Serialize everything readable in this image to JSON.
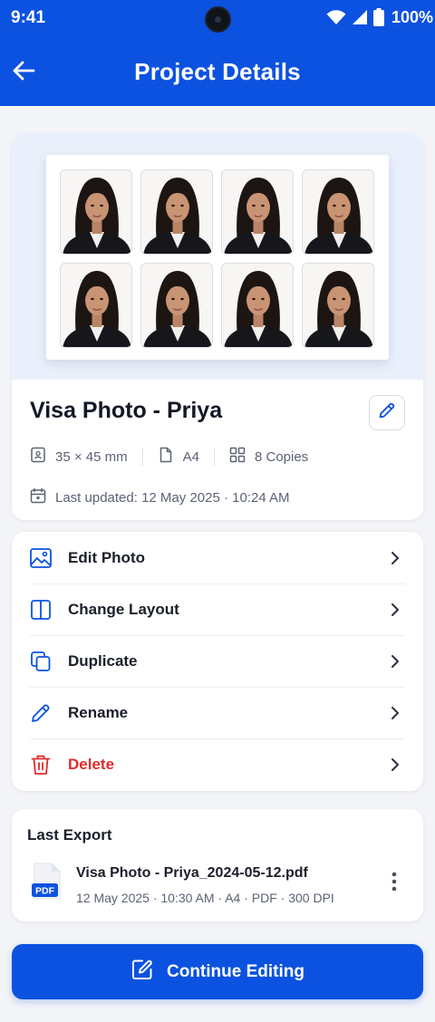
{
  "status_bar": {
    "time": "9:41",
    "battery": "100%",
    "icons": [
      "camera-cutout",
      "wifi-icon",
      "signal-icon",
      "battery-icon"
    ]
  },
  "app_bar": {
    "title": "Project Details",
    "back_icon": "arrow-left-icon"
  },
  "project": {
    "title": "Visa Photo - Priya",
    "photo_size": "35 × 45 mm",
    "paper": "A4",
    "copies": "8 Copies",
    "last_updated": "Last updated: 12 May 2025 · 10:24 AM",
    "preview_photos": 8
  },
  "actions": [
    {
      "label": "Edit Photo",
      "icon": "image-icon",
      "danger": false
    },
    {
      "label": "Change Layout",
      "icon": "layout-columns-icon",
      "danger": false
    },
    {
      "label": "Duplicate",
      "icon": "duplicate-icon",
      "danger": false
    },
    {
      "label": "Rename",
      "icon": "pencil-icon",
      "danger": false
    },
    {
      "label": "Delete",
      "icon": "trash-icon",
      "danger": true
    }
  ],
  "last_export": {
    "heading": "Last Export",
    "filename": "Visa Photo - Priya_2024-05-12.pdf",
    "meta": "12 May 2025 · 10:30 AM · A4 · PDF · 300 DPI",
    "file_badge": "PDF"
  },
  "primary_button": {
    "label": "Continue Editing"
  },
  "colors": {
    "primary": "#0c52e0",
    "danger": "#e02c2c",
    "preview_bg": "#eaf0fb",
    "text": "#1b1f2a",
    "muted": "#5c6275"
  }
}
